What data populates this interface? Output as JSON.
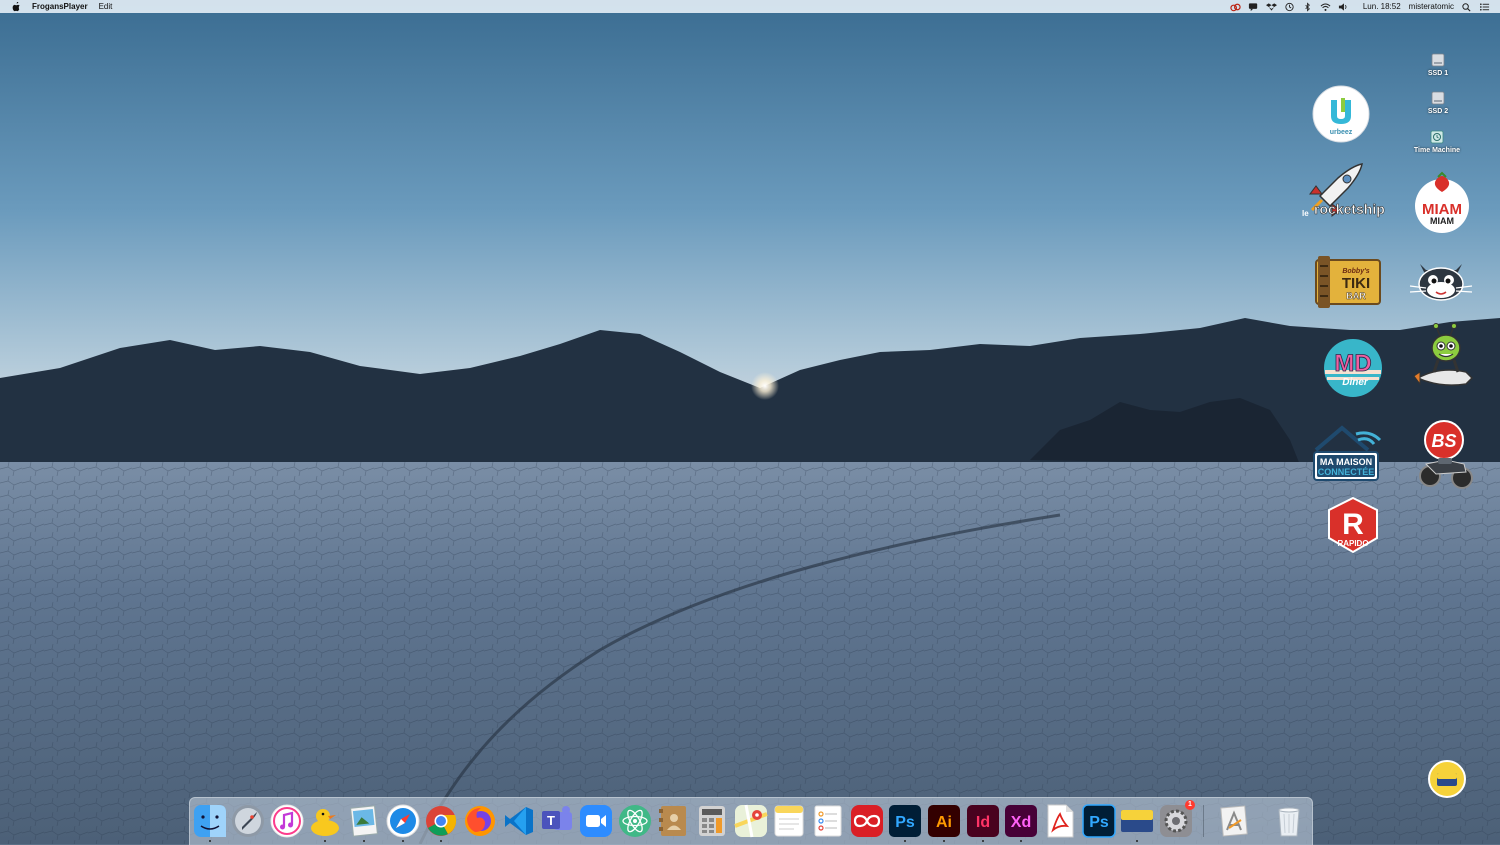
{
  "menubar": {
    "app_name": "FrogansPlayer",
    "menus": [
      "Edit"
    ],
    "clock": "Lun. 18:52",
    "user": "misteratomic",
    "status_icons": [
      "creative-cloud-icon",
      "messages-icon",
      "dropbox-icon",
      "time-machine-icon",
      "bluetooth-icon",
      "wifi-icon",
      "volume-icon"
    ]
  },
  "desktop": {
    "disks": [
      {
        "label": "SSD 1",
        "icon": "drive-icon"
      },
      {
        "label": "SSD 2",
        "icon": "drive-icon"
      },
      {
        "label": "Time Machine",
        "icon": "time-machine-drive-icon"
      }
    ],
    "stickers": {
      "urbeez": "urbeez",
      "rocketship_le": "le",
      "rocketship": "rocketship",
      "miam1": "MIAM",
      "miam2": "MIAM",
      "tiki_small": "Bobby's",
      "tiki": "TIKI",
      "tiki_bar": "BAR",
      "md": "MD",
      "md_sub": "Diner",
      "maison1": "MA MAISON",
      "maison2": "CONNECTÉE",
      "bs": "BS",
      "rapido_letter": "R",
      "rapido": "RAPIDO"
    }
  },
  "dock": {
    "apps": [
      {
        "name": "Finder",
        "icon": "finder-icon",
        "running": true
      },
      {
        "name": "Launchpad",
        "icon": "launchpad-icon",
        "running": false
      },
      {
        "name": "iTunes",
        "icon": "itunes-icon",
        "running": false
      },
      {
        "name": "Cyberduck",
        "icon": "duck-icon",
        "running": true
      },
      {
        "name": "Preview",
        "icon": "preview-icon",
        "running": true
      },
      {
        "name": "Safari",
        "icon": "safari-icon",
        "running": true
      },
      {
        "name": "Chrome",
        "icon": "chrome-icon",
        "running": true
      },
      {
        "name": "Firefox",
        "icon": "firefox-icon",
        "running": false
      },
      {
        "name": "VS Code",
        "icon": "vscode-icon",
        "running": false
      },
      {
        "name": "Teams",
        "icon": "teams-icon",
        "running": false
      },
      {
        "name": "Zoom",
        "icon": "zoom-icon",
        "running": false
      },
      {
        "name": "Atom",
        "icon": "atom-icon",
        "running": false
      },
      {
        "name": "Contacts",
        "icon": "contacts-icon",
        "running": false
      },
      {
        "name": "Calculator",
        "icon": "calculator-icon",
        "running": false
      },
      {
        "name": "Maps",
        "icon": "maps-icon",
        "running": false
      },
      {
        "name": "Notes",
        "icon": "notes-icon",
        "running": false
      },
      {
        "name": "Reminders",
        "icon": "reminders-icon",
        "running": false
      },
      {
        "name": "Creative Cloud",
        "icon": "creative-cloud-icon",
        "running": false
      },
      {
        "name": "Photoshop",
        "icon": "photoshop-icon",
        "running": true,
        "glyph": "Ps"
      },
      {
        "name": "Illustrator",
        "icon": "illustrator-icon",
        "running": true,
        "glyph": "Ai"
      },
      {
        "name": "InDesign",
        "icon": "indesign-icon",
        "running": true,
        "glyph": "Id"
      },
      {
        "name": "Adobe XD",
        "icon": "xd-icon",
        "running": true,
        "glyph": "Xd"
      },
      {
        "name": "Acrobat",
        "icon": "acrobat-icon",
        "running": false
      },
      {
        "name": "Photoshop 2",
        "icon": "photoshop-icon",
        "running": false,
        "glyph": "Ps"
      },
      {
        "name": "FrogansPlayer",
        "icon": "frogans-icon",
        "running": true
      },
      {
        "name": "System Preferences",
        "icon": "system-preferences-icon",
        "running": false,
        "badge": "1"
      }
    ],
    "stack": {
      "name": "Applications",
      "icon": "applications-folder-icon"
    },
    "trash": {
      "name": "Trash",
      "icon": "trash-icon"
    }
  },
  "colors": {
    "sky_top": "#3c6f93",
    "sky_horizon": "#e9dfe4",
    "mountains": "#223142",
    "playa": "#56697f",
    "menubar": "#e1ecf4"
  }
}
